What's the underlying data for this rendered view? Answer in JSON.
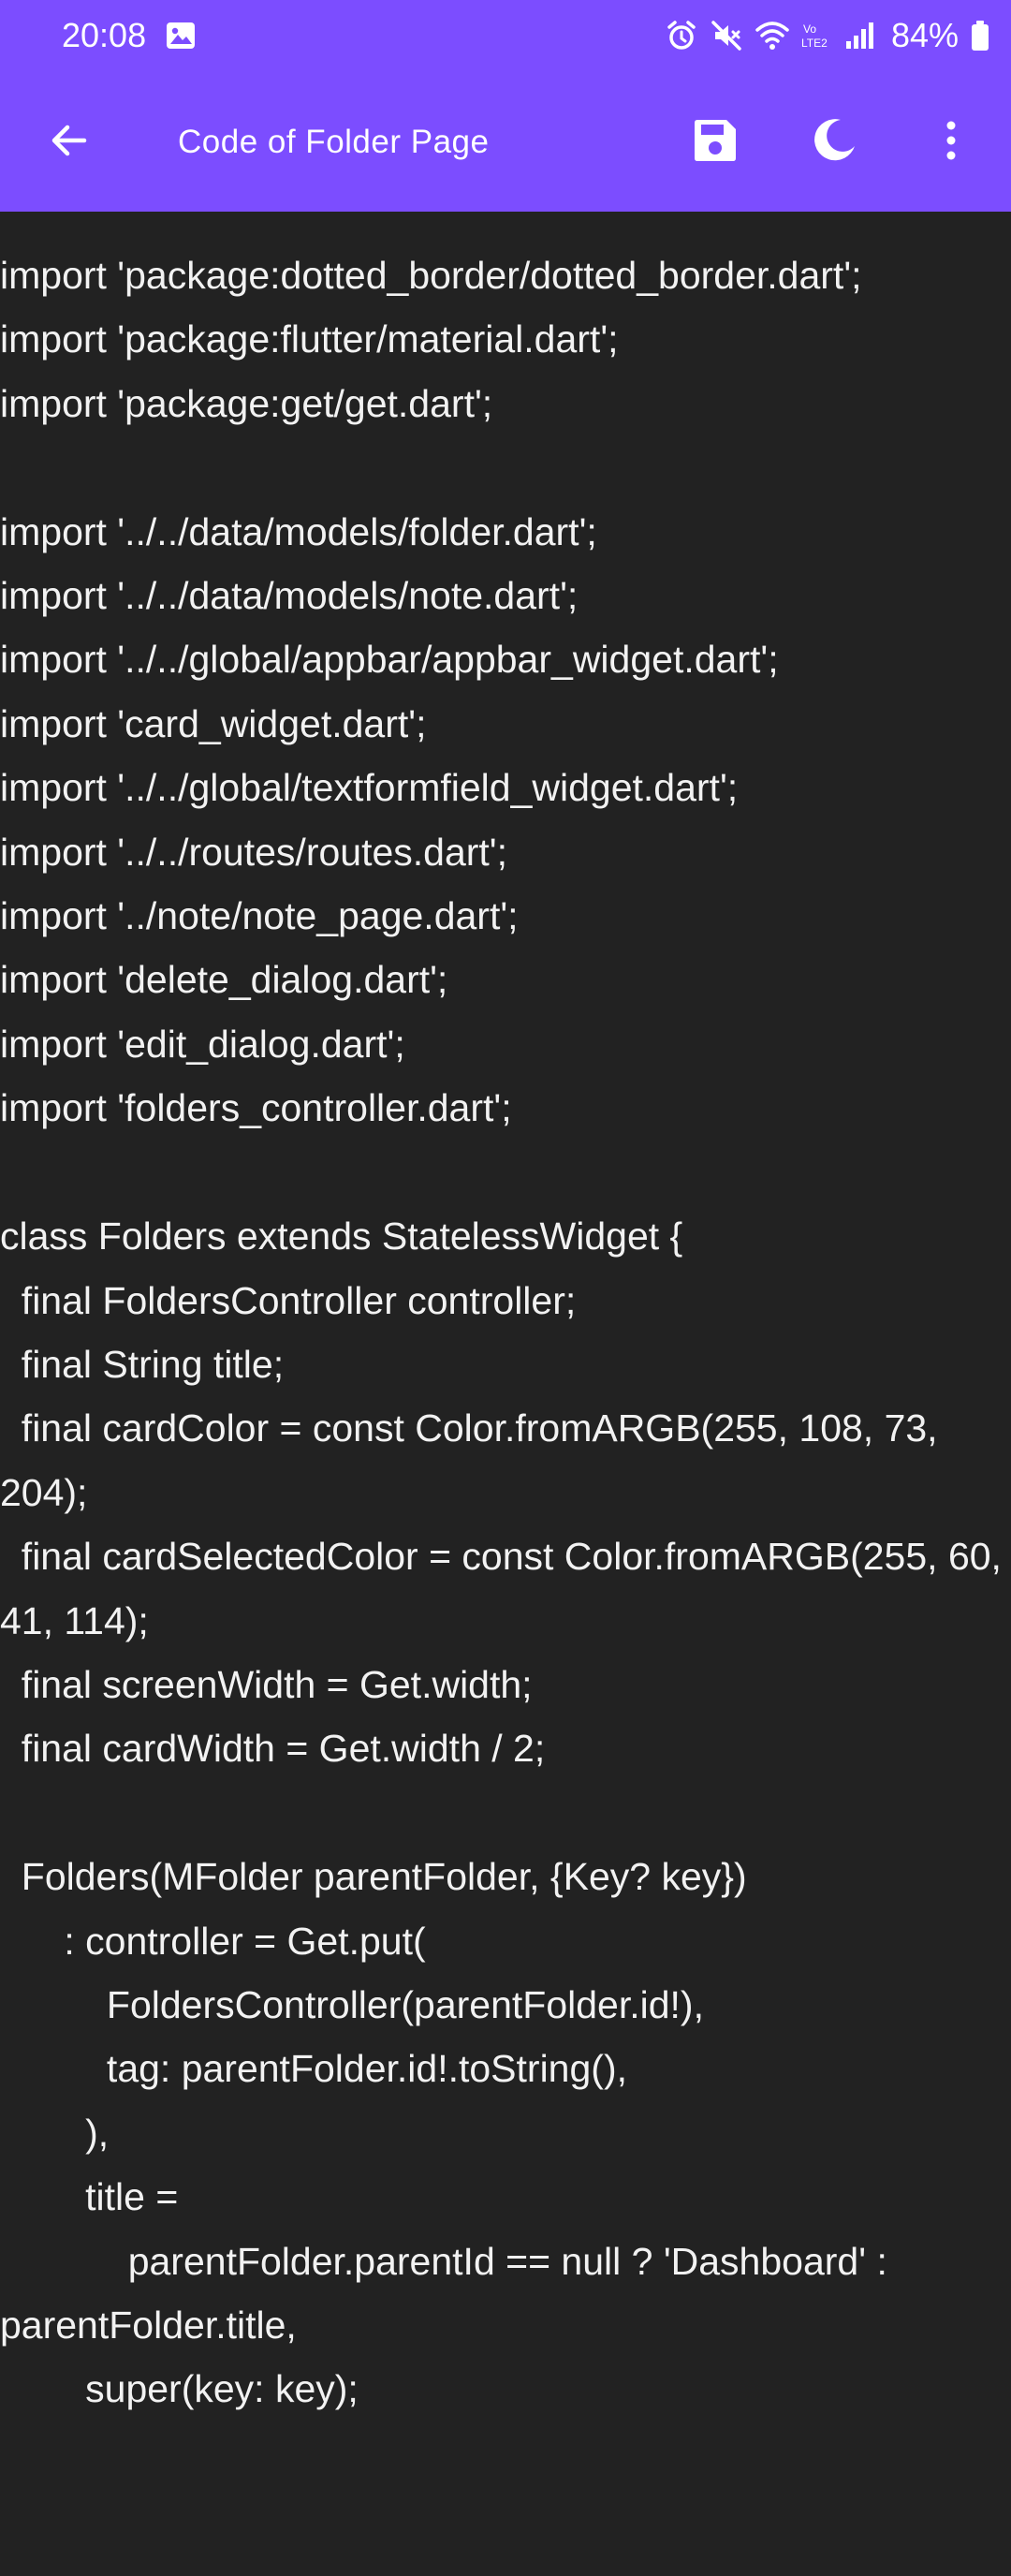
{
  "status_bar": {
    "time": "20:08",
    "battery": "84%",
    "icons": [
      "image-icon",
      "alarm-icon",
      "mute-icon",
      "wifi-icon",
      "volte-icon",
      "signal-icon",
      "battery-icon"
    ]
  },
  "app_bar": {
    "title": "Code of Folder Page",
    "back_icon": "arrow-back-icon",
    "actions": [
      "save-icon",
      "dark-mode-icon",
      "more-vert-icon"
    ]
  },
  "colors": {
    "app_bar": "#7c4dff",
    "background": "#222222",
    "code_text": "#f2f2f2"
  },
  "code": {
    "content": "import 'package:dotted_border/dotted_border.dart';\nimport 'package:flutter/material.dart';\nimport 'package:get/get.dart';\n\nimport '../../data/models/folder.dart';\nimport '../../data/models/note.dart';\nimport '../../global/appbar/appbar_widget.dart';\nimport 'card_widget.dart';\nimport '../../global/textformfield_widget.dart';\nimport '../../routes/routes.dart';\nimport '../note/note_page.dart';\nimport 'delete_dialog.dart';\nimport 'edit_dialog.dart';\nimport 'folders_controller.dart';\n\nclass Folders extends StatelessWidget {\n  final FoldersController controller;\n  final String title;\n  final cardColor = const Color.fromARGB(255, 108, 73, 204);\n  final cardSelectedColor = const Color.fromARGB(255, 60, 41, 114);\n  final screenWidth = Get.width;\n  final cardWidth = Get.width / 2;\n\n  Folders(MFolder parentFolder, {Key? key})\n      : controller = Get.put(\n          FoldersController(parentFolder.id!),\n          tag: parentFolder.id!.toString(),\n        ),\n        title =\n            parentFolder.parentId == null ? 'Dashboard' : parentFolder.title,\n        super(key: key);"
  }
}
